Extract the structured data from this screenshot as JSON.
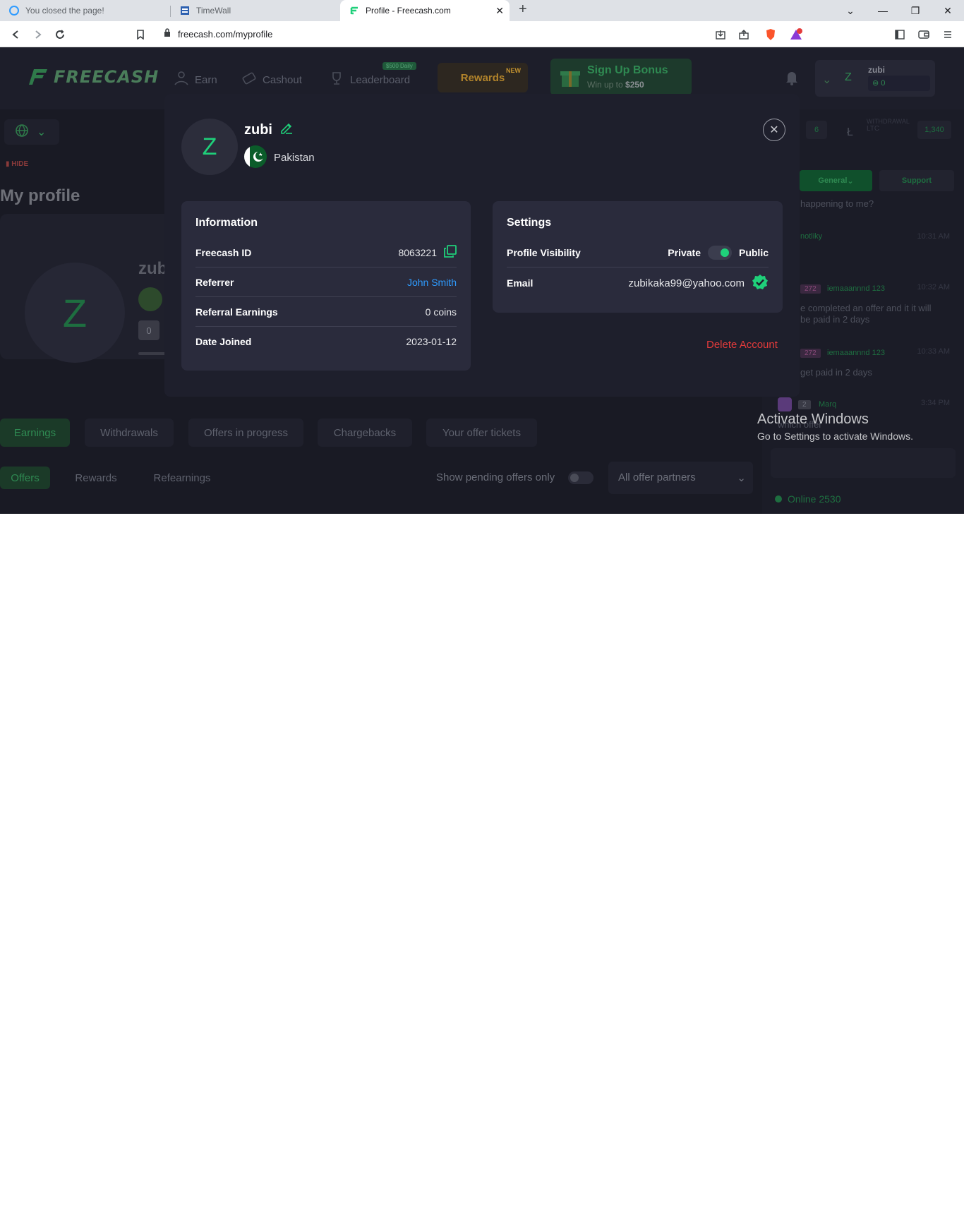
{
  "browser": {
    "tabs": [
      {
        "title": "You closed the page!",
        "active": false
      },
      {
        "title": "TimeWall",
        "active": false
      },
      {
        "title": "Profile - Freecash.com",
        "active": true
      }
    ],
    "url": "freecash.com/myprofile"
  },
  "nav": {
    "logo": "FREECASH",
    "earn": "Earn",
    "cashout": "Cashout",
    "leaderboard": "Leaderboard",
    "leaderboard_badge": "$500 Daily",
    "rewards": "Rewards",
    "rewards_badge": "NEW",
    "signup_title": "Sign Up Bonus",
    "signup_sub": "Win up to ",
    "signup_amount": "$250",
    "user_initial": "Z",
    "user_name": "zubi",
    "user_balance": "0"
  },
  "background": {
    "hide": "HIDE",
    "page_title": "My profile",
    "profile_name": "zub",
    "level": "0",
    "tabs": [
      "Earnings",
      "Withdrawals",
      "Offers in progress",
      "Chargebacks",
      "Your offer tickets"
    ],
    "subtabs": [
      "Offers",
      "Rewards",
      "Refearnings"
    ],
    "pending_label": "Show pending offers only",
    "partners": "All offer partners"
  },
  "chat": {
    "count": "6",
    "withdrawal_label": "WITHDRAWAL",
    "withdrawal_currency": "LTC",
    "withdrawal_amount": "1,340",
    "tab_general": "General",
    "tab_support": "Support",
    "messages": [
      {
        "name": "",
        "time": "",
        "text": "happening to me?"
      },
      {
        "name": "notliky",
        "time": "10:31 AM",
        "text": ""
      },
      {
        "level": "272",
        "name": "iemaaannnd 123",
        "time": "10:32 AM",
        "text": "e completed an offer and it it will be paid in 2 days"
      },
      {
        "level": "272",
        "name": "iemaaannnd 123",
        "time": "10:33 AM",
        "text": "get paid in 2 days"
      },
      {
        "level": "2",
        "name": "Marq",
        "time": "3:34 PM",
        "text": "which offer"
      }
    ],
    "online": "Online 2530"
  },
  "windows_notice": {
    "title": "Activate Windows",
    "subtitle": "Go to Settings to activate Windows."
  },
  "modal": {
    "initial": "Z",
    "name": "zubi",
    "country": "Pakistan",
    "information": {
      "title": "Information",
      "freecash_id_label": "Freecash ID",
      "freecash_id": "8063221",
      "referrer_label": "Referrer",
      "referrer": "John Smith",
      "referral_earnings_label": "Referral Earnings",
      "referral_earnings": "0 coins",
      "date_joined_label": "Date Joined",
      "date_joined": "2023-01-12"
    },
    "settings": {
      "title": "Settings",
      "visibility_label": "Profile Visibility",
      "private": "Private",
      "public": "Public",
      "email_label": "Email",
      "email": "zubikaka99@yahoo.com"
    },
    "delete": "Delete Account"
  },
  "colors": {
    "accent": "#1fd07a",
    "link": "#2e9bff",
    "danger": "#e43b3b",
    "modal_bg": "#1e1f2c",
    "panel_bg": "#2a2b3c"
  }
}
